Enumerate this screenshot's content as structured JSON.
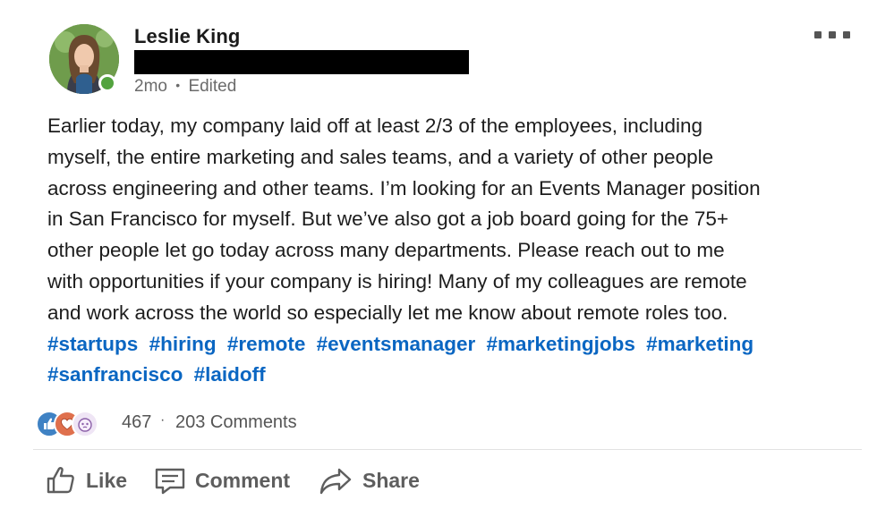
{
  "post": {
    "author": {
      "name": "Leslie King",
      "online": true
    },
    "meta": {
      "time": "2mo",
      "separator": "•",
      "edited": "Edited"
    },
    "body_lines": [
      "Earlier today, my company laid off at least 2/3 of the employees, including",
      "myself, the entire marketing and sales teams, and a variety of other people",
      "across engineering and other teams. I’m looking for an Events Manager position",
      "in San Francisco for myself. But we’ve also got a job board going for the 75+",
      "other people let go today across many departments. Please reach out to me",
      "with opportunities if your company is hiring! Many of my colleagues are remote",
      "and work across the world so especially let me know about remote roles too."
    ],
    "hashtags": [
      "#startups",
      "#hiring",
      "#remote",
      "#eventsmanager",
      "#marketingjobs",
      "#marketing",
      "#sanfrancisco",
      "#laidoff"
    ],
    "social": {
      "reactions": [
        "like-reaction-icon",
        "love-reaction-icon",
        "curious-reaction-icon"
      ],
      "reaction_count": "467",
      "separator": "·",
      "comments": "203 Comments"
    },
    "actions": {
      "like": "Like",
      "comment": "Comment",
      "share": "Share"
    }
  },
  "colors": {
    "hashtag": "#0a66c2",
    "online": "#53a33f",
    "like": "#3f82c4",
    "love": "#df704d"
  }
}
